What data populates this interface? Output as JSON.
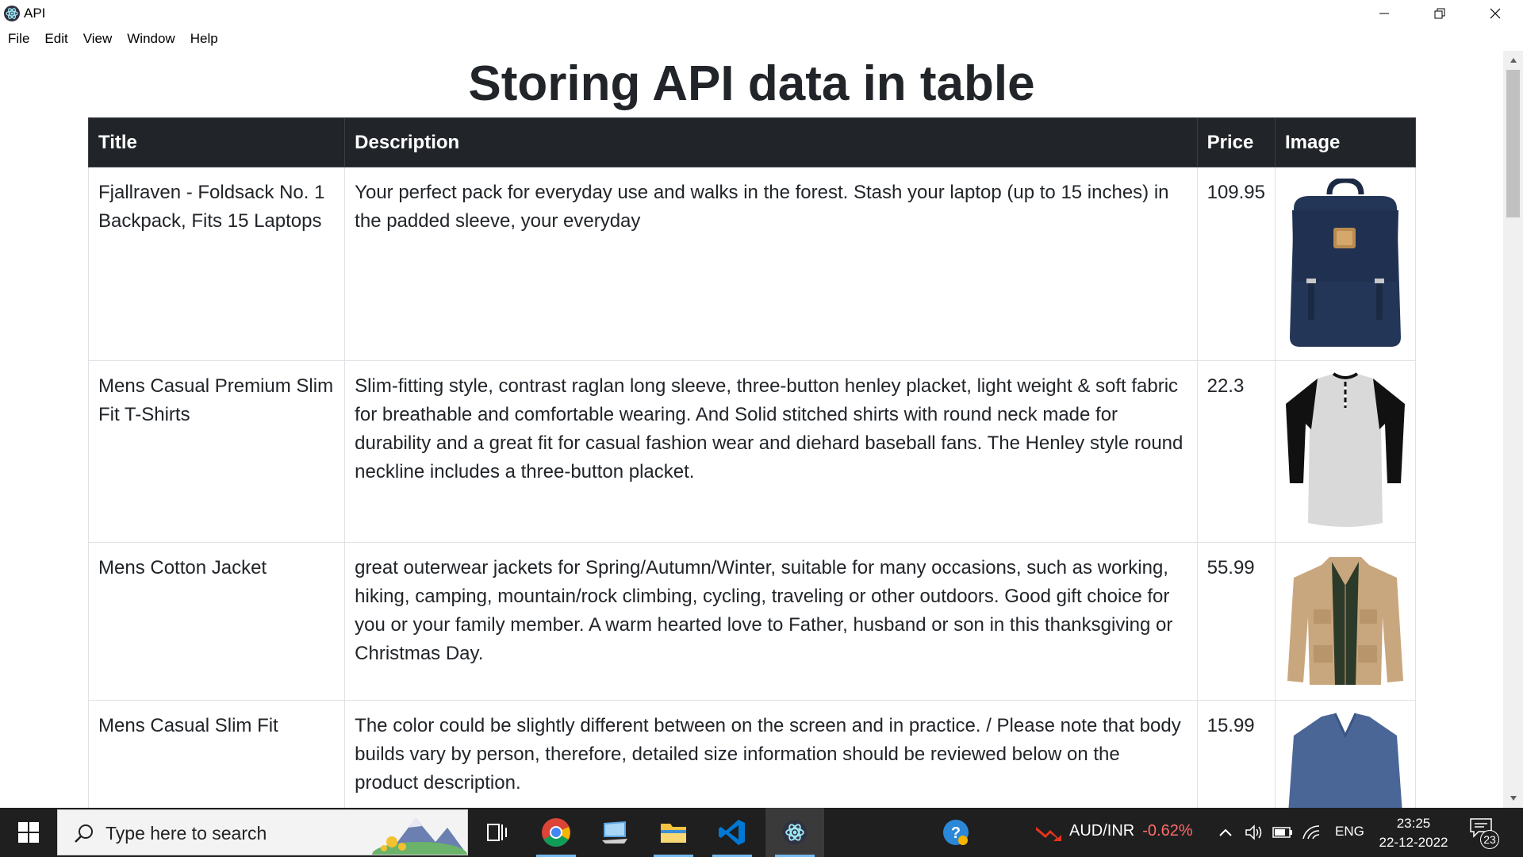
{
  "window": {
    "title": "API",
    "menu": [
      "File",
      "Edit",
      "View",
      "Window",
      "Help"
    ]
  },
  "page": {
    "heading": "Storing API data in table",
    "table": {
      "headers": [
        "Title",
        "Description",
        "Price",
        "Image"
      ],
      "rows": [
        {
          "title": "Fjallraven - Foldsack No. 1 Backpack, Fits 15 Laptops",
          "description": "Your perfect pack for everyday use and walks in the forest. Stash your laptop (up to 15 inches) in the padded sleeve, your everyday",
          "price": "109.95",
          "image": "backpack-image"
        },
        {
          "title": "Mens Casual Premium Slim Fit T-Shirts",
          "description": "Slim-fitting style, contrast raglan long sleeve, three-button henley placket, light weight & soft fabric for breathable and comfortable wearing. And Solid stitched shirts with round neck made for durability and a great fit for casual fashion wear and diehard baseball fans. The Henley style round neckline includes a three-button placket.",
          "price": "22.3",
          "image": "tshirt-image"
        },
        {
          "title": "Mens Cotton Jacket",
          "description": "great outerwear jackets for Spring/Autumn/Winter, suitable for many occasions, such as working, hiking, camping, mountain/rock climbing, cycling, traveling or other outdoors. Good gift choice for you or your family member. A warm hearted love to Father, husband or son in this thanksgiving or Christmas Day.",
          "price": "55.99",
          "image": "jacket-image"
        },
        {
          "title": "Mens Casual Slim Fit",
          "description": "The color could be slightly different between on the screen and in practice. / Please note that body builds vary by person, therefore, detailed size information should be reviewed below on the product description.",
          "price": "15.99",
          "image": "longsleeve-image"
        }
      ]
    }
  },
  "taskbar": {
    "search_placeholder": "Type here to search",
    "ticker_symbol": "AUD/INR",
    "ticker_change": "-0.62%",
    "language": "ENG",
    "time": "23:25",
    "date": "22-12-2022",
    "notification_count": "23"
  },
  "colors": {
    "table_header_bg": "#212529",
    "ticker_down": "#ff6b6b",
    "taskbar_bg": "#1f1f1f"
  }
}
